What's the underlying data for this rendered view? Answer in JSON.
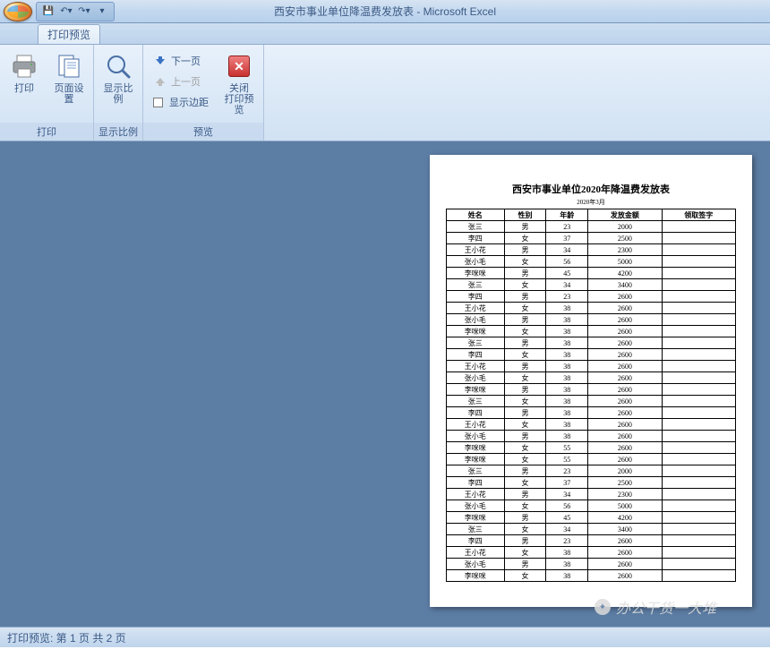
{
  "title": "西安市事业单位降温费发放表 - Microsoft Excel",
  "tab": {
    "label": "打印预览"
  },
  "ribbon": {
    "print_group": {
      "label": "打印",
      "print": "打印",
      "page_setup": "页面设置"
    },
    "zoom_group": {
      "label": "显示比例",
      "zoom": "显示比例"
    },
    "preview_group": {
      "label": "预览",
      "next_page": "下一页",
      "prev_page": "上一页",
      "show_margins": "显示边距",
      "close_top": "关闭",
      "close_bottom": "打印预览"
    }
  },
  "document": {
    "title": "西安市事业单位2020年降温费发放表",
    "subtitle": "2020年3月",
    "headers": [
      "姓名",
      "性别",
      "年龄",
      "发放金额",
      "领取签字"
    ],
    "rows": [
      [
        "张三",
        "男",
        "23",
        "2000",
        ""
      ],
      [
        "李四",
        "女",
        "37",
        "2500",
        ""
      ],
      [
        "王小花",
        "男",
        "34",
        "2300",
        ""
      ],
      [
        "张小毛",
        "女",
        "56",
        "5000",
        ""
      ],
      [
        "李咪咪",
        "男",
        "45",
        "4200",
        ""
      ],
      [
        "张三",
        "女",
        "34",
        "3400",
        ""
      ],
      [
        "李四",
        "男",
        "23",
        "2600",
        ""
      ],
      [
        "王小花",
        "女",
        "38",
        "2600",
        ""
      ],
      [
        "张小毛",
        "男",
        "38",
        "2600",
        ""
      ],
      [
        "李咪咪",
        "女",
        "38",
        "2600",
        ""
      ],
      [
        "张三",
        "男",
        "38",
        "2600",
        ""
      ],
      [
        "李四",
        "女",
        "38",
        "2600",
        ""
      ],
      [
        "王小花",
        "男",
        "38",
        "2600",
        ""
      ],
      [
        "张小毛",
        "女",
        "38",
        "2600",
        ""
      ],
      [
        "李咪咪",
        "男",
        "38",
        "2600",
        ""
      ],
      [
        "张三",
        "女",
        "38",
        "2600",
        ""
      ],
      [
        "李四",
        "男",
        "38",
        "2600",
        ""
      ],
      [
        "王小花",
        "女",
        "38",
        "2600",
        ""
      ],
      [
        "张小毛",
        "男",
        "38",
        "2600",
        ""
      ],
      [
        "李咪咪",
        "女",
        "55",
        "2600",
        ""
      ],
      [
        "李咪咪",
        "女",
        "55",
        "2600",
        ""
      ],
      [
        "张三",
        "男",
        "23",
        "2000",
        ""
      ],
      [
        "李四",
        "女",
        "37",
        "2500",
        ""
      ],
      [
        "王小花",
        "男",
        "34",
        "2300",
        ""
      ],
      [
        "张小毛",
        "女",
        "56",
        "5000",
        ""
      ],
      [
        "李咪咪",
        "男",
        "45",
        "4200",
        ""
      ],
      [
        "张三",
        "女",
        "34",
        "3400",
        ""
      ],
      [
        "李四",
        "男",
        "23",
        "2600",
        ""
      ],
      [
        "王小花",
        "女",
        "38",
        "2600",
        ""
      ],
      [
        "张小毛",
        "男",
        "38",
        "2600",
        ""
      ],
      [
        "李咪咪",
        "女",
        "38",
        "2600",
        ""
      ]
    ]
  },
  "status": "打印预览: 第 1 页  共 2 页",
  "watermark": "办公干货一大堆"
}
